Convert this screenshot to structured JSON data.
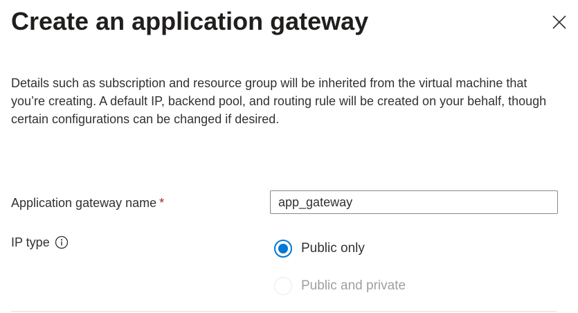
{
  "panel": {
    "title": "Create an application gateway",
    "close_label": "Close",
    "description": "Details such as subscription and resource group will be inherited from the virtual machine that you’re creating. A default IP, backend pool, and routing rule will be created on your behalf, though certain configurations can be changed if desired."
  },
  "form": {
    "name_field": {
      "label": "Application gateway name",
      "required_marker": "*",
      "value": "app_gateway"
    },
    "ip_type": {
      "label": "IP type",
      "info_icon": "info-icon",
      "options": [
        {
          "label": "Public only",
          "selected": true,
          "disabled": false
        },
        {
          "label": "Public and private",
          "selected": false,
          "disabled": true
        }
      ]
    }
  },
  "colors": {
    "accent": "#0078d4",
    "required": "#a4262c",
    "disabled_text": "#a19f9d",
    "text": "#323130"
  }
}
